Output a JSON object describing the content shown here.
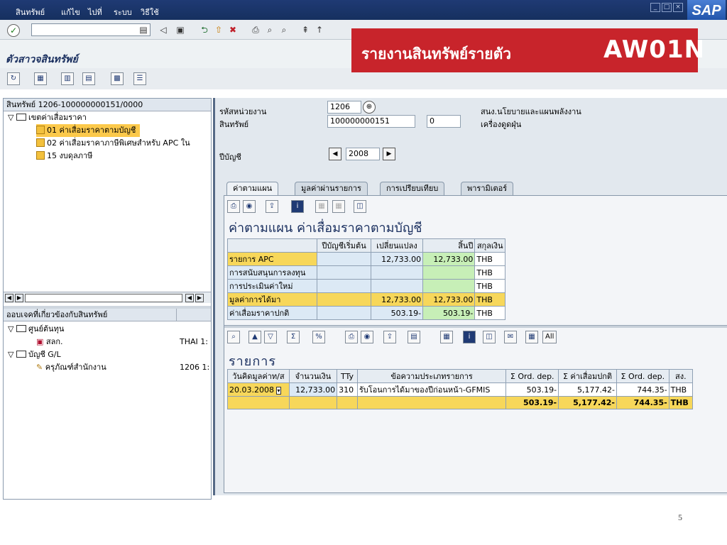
{
  "menu": [
    "สินทรัพย์",
    "แก้ไข",
    "ไปที่",
    "ระบบ",
    "วิธีใช้"
  ],
  "sap_logo": "SAP",
  "screen_title": "ตัวสาวจสินทรัพย์",
  "banner": {
    "thai": "รายงานสินทรัพย์รายตัว",
    "code": "AW01N"
  },
  "tree": {
    "header": "สินทรัพย์ 1206-100000000151/0000",
    "group": "เขตค่าเสื่อมราคา",
    "items": [
      "01 ค่าเสื่อมราคาตามบัญชี",
      "02 ค่าเสื่อมราคาภาษีพิเศษสำหรับ APC ใน",
      "15 งบดุลภาษี"
    ]
  },
  "obj_panel": {
    "header": "ออบเจคที่เกี่ยวข้องกับสินทรัพย์",
    "cost_center_group": "ศูนย์ต้นทุน",
    "cost_center": "สลก.",
    "cost_center_value": "THAI 1:",
    "gl_group": "บัญชี G/L",
    "gl_item": "ครุภัณฑ์สำนักงาน",
    "gl_value": "1206 1:"
  },
  "header_fields": {
    "company_label": "รหัสหน่วยงาน",
    "company_value": "1206",
    "company_desc": "สนง.นโยบายและแผนพลังงาน",
    "asset_label": "สินทรัพย์",
    "asset_value": "100000000151",
    "sub_value": "0",
    "asset_desc": "เครื่องดูดฝุ่น",
    "fy_label": "ปีบัญชี",
    "fy_value": "2008"
  },
  "tabs": [
    "ค่าตามแผน",
    "มูลค่าผ่านรายการ",
    "การเปรียบเทียบ",
    "พารามิเตอร์"
  ],
  "plan_title": "ค่าตามแผน ค่าเสื่อมราคาตามบัญชี",
  "plan_table": {
    "headers": [
      "",
      "ปีบัญชีเริ่มต้น",
      "เปลี่ยนแปลง",
      "สิ้นปี",
      "สกุลเงิน"
    ],
    "rows": [
      [
        "รายการ APC",
        "",
        "12,733.00",
        "12,733.00",
        "THB"
      ],
      [
        "การสนับสนุนการลงทุน",
        "",
        "",
        "",
        "THB"
      ],
      [
        "การประเมินค่าใหม่",
        "",
        "",
        "",
        "THB"
      ],
      [
        "มูลค่าการได้มา",
        "",
        "12,733.00",
        "12,733.00",
        "THB"
      ],
      [
        "ค่าเสื่อมราคาปกติ",
        "",
        "503.19-",
        "503.19-",
        "THB"
      ]
    ]
  },
  "items_title": "รายการ",
  "items_toolbar_all": "All",
  "items_table": {
    "headers": [
      "วันคิดมูลค่าท/ส",
      "จำนวนเงิน",
      "TTy",
      "ข้อความประเภทรายการ",
      "Σ Ord. dep.",
      "Σ ค่าเสื่อมปกติ",
      "Σ Ord. dep.",
      "สง."
    ],
    "row": [
      "20.03.2008",
      "12,733.00",
      "310",
      "รับโอนการได้มาของปีก่อนหน้า-GFMIS",
      "503.19-",
      "5,177.42-",
      "744.35-",
      "THB"
    ],
    "total": [
      "503.19-",
      "5,177.42-",
      "744.35-",
      "THB"
    ]
  },
  "slide_number": "5"
}
